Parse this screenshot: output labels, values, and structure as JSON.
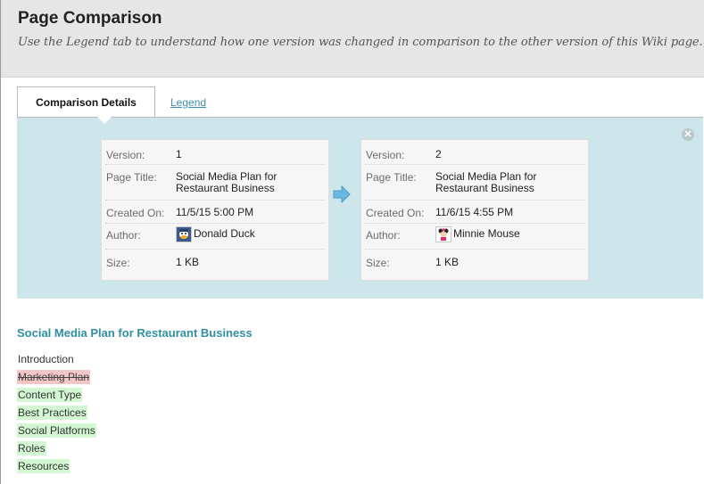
{
  "header": {
    "title": "Page Comparison",
    "subtitle": "Use the Legend tab to understand how one version was changed in comparison to the other version of this Wiki page."
  },
  "tabs": [
    {
      "label": "Comparison Details"
    },
    {
      "label": "Legend"
    }
  ],
  "comparison": {
    "close_glyph": "✕",
    "labels": {
      "version": "Version:",
      "page_title": "Page Title:",
      "created_on": "Created On:",
      "author": "Author:",
      "size": "Size:"
    },
    "left": {
      "version": "1",
      "page_title": "Social Media Plan for Restaurant Business",
      "created_on": "11/5/15 5:00 PM",
      "author": "Donald Duck",
      "avatar_icon": "donald-duck-avatar",
      "size": "1 KB"
    },
    "right": {
      "version": "2",
      "page_title": "Social Media Plan for Restaurant Business",
      "created_on": "11/6/15 4:55 PM",
      "author": "Minnie Mouse",
      "avatar_icon": "minnie-mouse-avatar",
      "size": "1 KB"
    },
    "arrow_icon": "right-arrow-icon",
    "arrow_color": "#6bb9dc"
  },
  "document": {
    "title": "Social Media Plan for Restaurant Business",
    "items": [
      {
        "text": "Introduction",
        "status": "unchanged"
      },
      {
        "text": "Marketing Plan",
        "status": "deleted"
      },
      {
        "text": "Content Type",
        "status": "added"
      },
      {
        "text": "Best Practices",
        "status": "added"
      },
      {
        "text": "Social Platforms",
        "status": "added"
      },
      {
        "text": "Roles",
        "status": "added"
      },
      {
        "text": "Resources",
        "status": "added"
      }
    ]
  },
  "colors": {
    "accent": "#2f8fa0",
    "link": "#3b8fb0",
    "panel": "#cde6eb",
    "deleted": "#f4c7c7",
    "added": "#d2f7d2"
  }
}
